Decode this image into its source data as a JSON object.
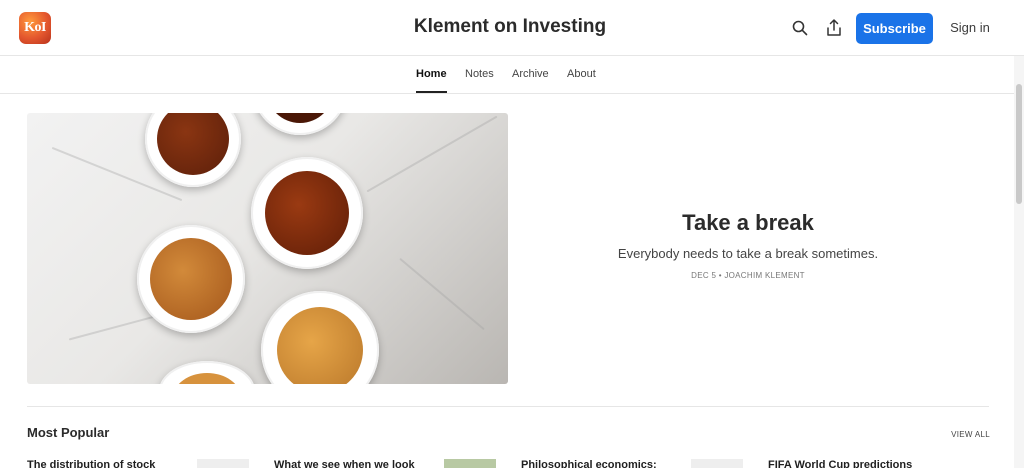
{
  "header": {
    "logo_text": "KoI",
    "site_title": "Klement on Investing",
    "subscribe_label": "Subscribe",
    "signin_label": "Sign in",
    "icons": [
      "search-icon",
      "share-icon"
    ]
  },
  "nav": {
    "items": [
      {
        "label": "Home",
        "active": true
      },
      {
        "label": "Notes"
      },
      {
        "label": "Archive"
      },
      {
        "label": "About"
      }
    ]
  },
  "hero": {
    "title": "Take a break",
    "subtitle": "Everybody needs to take a break sometimes.",
    "meta": "DEC 5 • JOACHIM KLEMENT"
  },
  "popular": {
    "section_title": "Most Popular",
    "view_all_label": "VIEW ALL",
    "posts": [
      {
        "title": "The distribution of stock"
      },
      {
        "title": "What we see when we look"
      },
      {
        "title": "Philosophical economics:"
      },
      {
        "title": "FIFA World Cup predictions"
      }
    ]
  },
  "colors": {
    "accent": "#1a73e8",
    "logo_gradient": "#e4572e"
  }
}
